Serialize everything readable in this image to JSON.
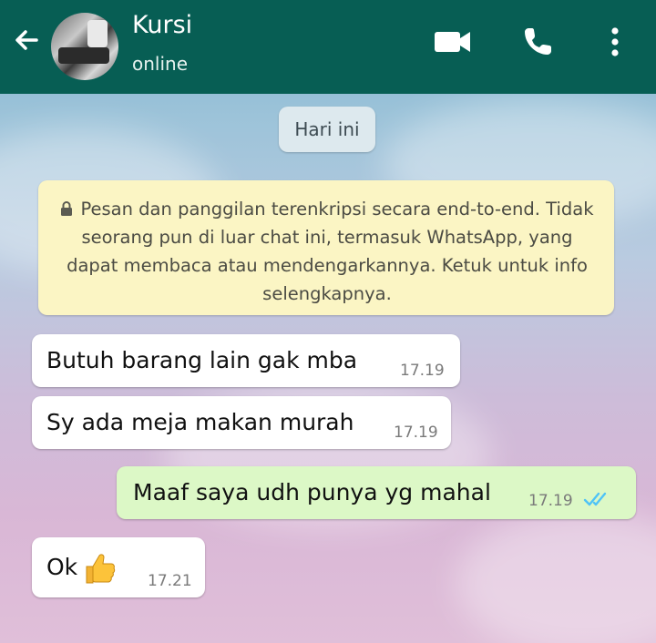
{
  "header": {
    "contact_name": "Kursi",
    "status": "online",
    "icons": [
      "back-arrow-icon",
      "video-call-icon",
      "phone-icon",
      "more-menu-icon"
    ],
    "color": "#075e54"
  },
  "date_separator": "Hari ini",
  "encryption_notice": "Pesan dan panggilan terenkripsi secara end-to-end. Tidak seorang pun di luar chat ini, termasuk WhatsApp, yang dapat membaca atau mendengarkannya. Ketuk untuk info selengkapnya.",
  "messages": [
    {
      "direction": "incoming",
      "text": "Butuh barang lain gak mba",
      "time": "17.19"
    },
    {
      "direction": "incoming",
      "text": "Sy ada meja makan murah",
      "time": "17.19"
    },
    {
      "direction": "outgoing",
      "text": "Maaf saya udh punya yg mahal",
      "time": "17.19",
      "status": "read"
    },
    {
      "direction": "incoming",
      "text": "Ok",
      "emoji": "thumbs-up-icon",
      "time": "17.21"
    }
  ],
  "colors": {
    "incoming_bubble": "#ffffff",
    "outgoing_bubble": "#dcf8c6",
    "notice_bubble": "#fbf5c4",
    "read_ticks": "#4fc3f7"
  }
}
